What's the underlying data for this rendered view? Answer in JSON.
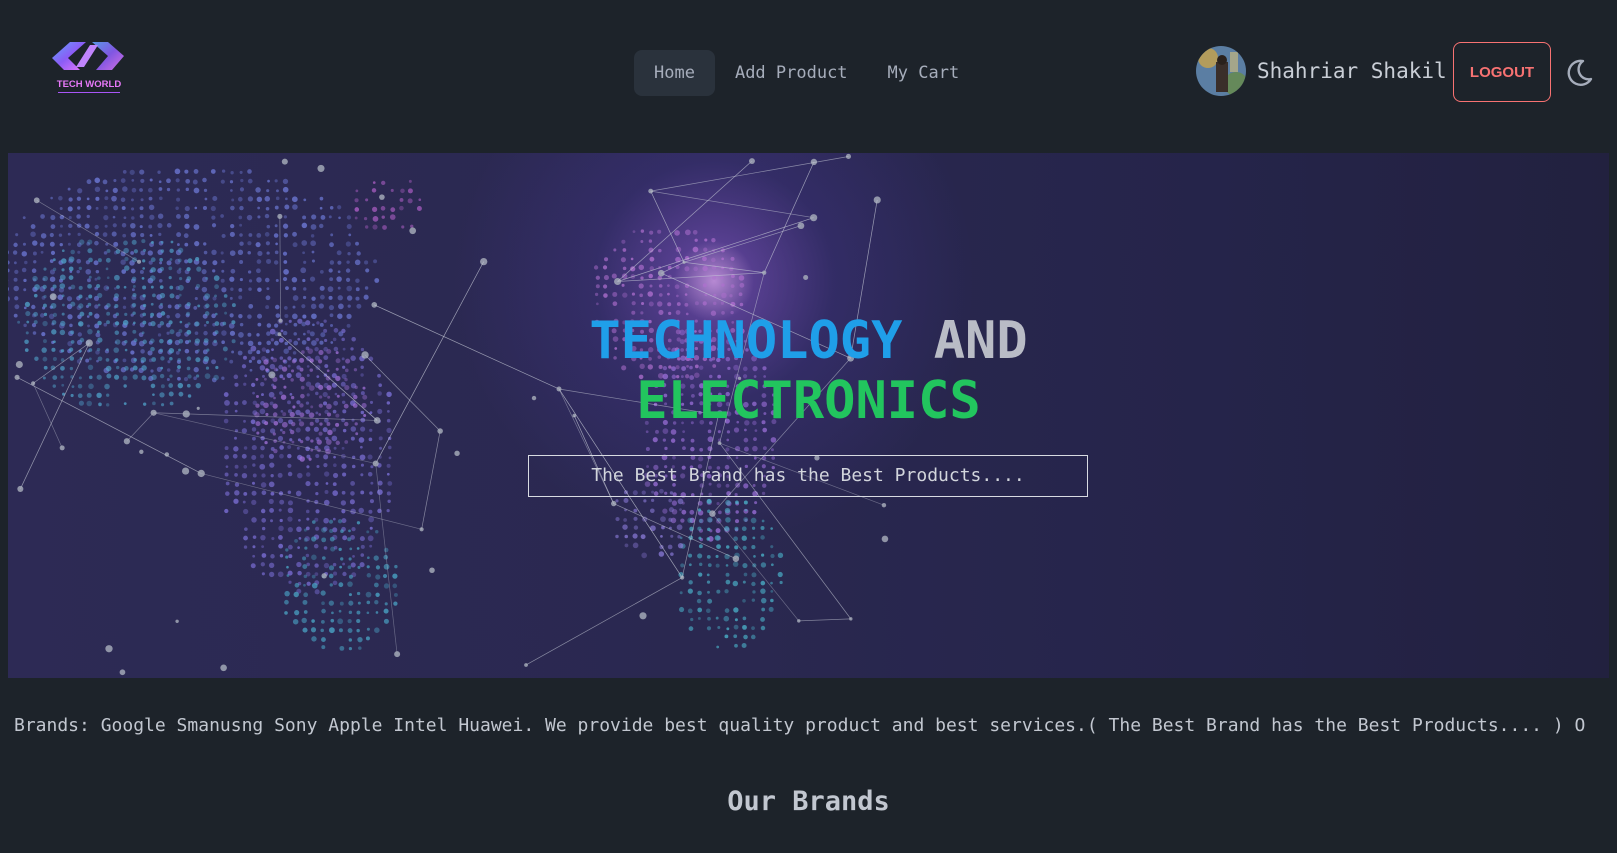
{
  "brand": {
    "logo_text": "TECH WORLD"
  },
  "nav": {
    "links": [
      {
        "label": "Home",
        "active": true
      },
      {
        "label": "Add Product",
        "active": false
      },
      {
        "label": "My Cart",
        "active": false
      }
    ]
  },
  "user": {
    "name": "Shahriar Shakil",
    "logout_label": "LOGOUT",
    "theme_icon": "moon-icon"
  },
  "hero": {
    "title_word1": "TECHNOLOGY",
    "title_word2": "AND",
    "title_word3": "ELECTRONICS",
    "tagline": "The Best Brand has the Best Products...."
  },
  "marquee": {
    "text": "Brands: Google Smanusng Sony Apple Intel Huawei. We provide best quality product and best services.( The Best Brand has the Best Products.... ) O"
  },
  "sections": {
    "brands_title": "Our Brands"
  },
  "colors": {
    "background": "#1d232a",
    "title_blue": "#1f9fe9",
    "title_green": "#22c55e",
    "logout_red": "#f87272",
    "active_nav_bg": "#2a323c"
  }
}
